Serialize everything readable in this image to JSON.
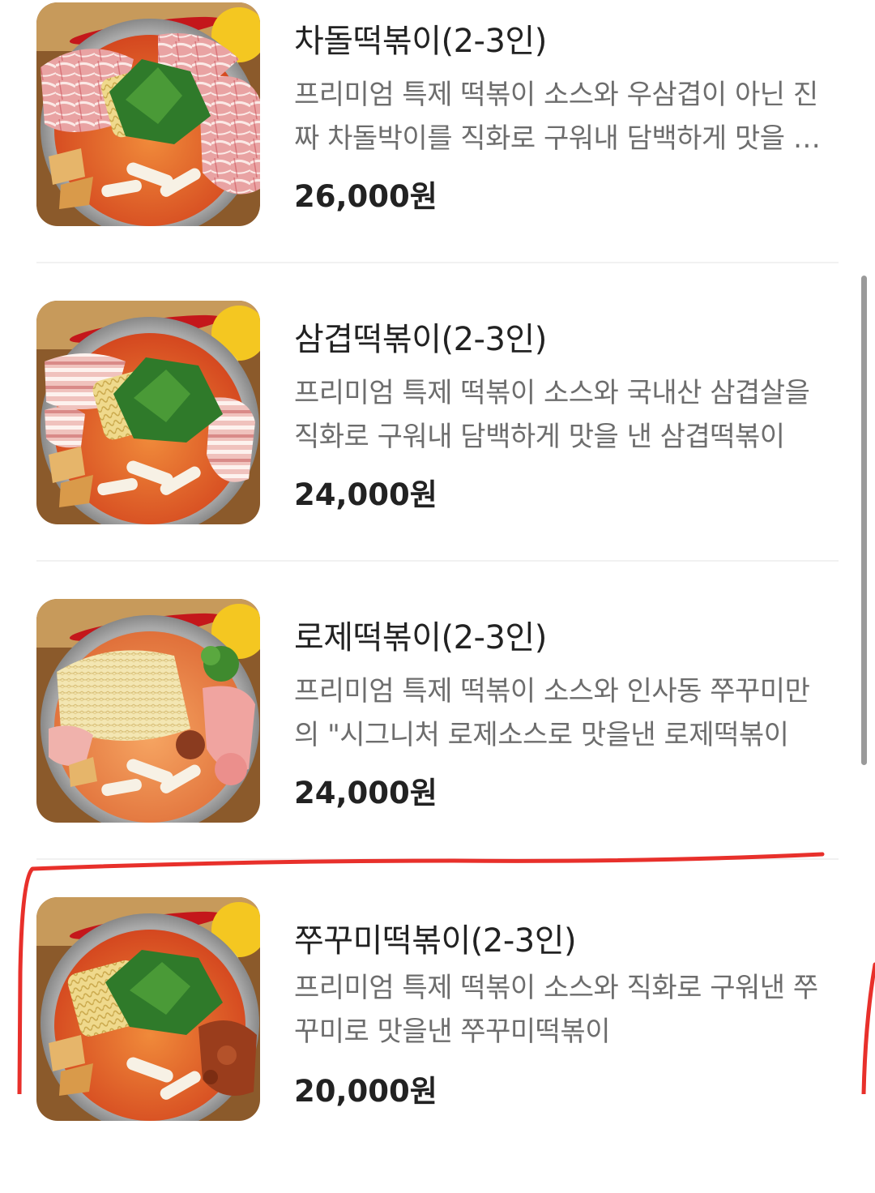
{
  "menu_items": [
    {
      "title": "차돌떡볶이(2-3인)",
      "description": "프리미엄 특제 떡볶이 소스와 우삼겹이 아닌 진짜 차돌박이를 직화로 구워내 담백하게 맛을 낸 차돌떡볶이",
      "price": "26,000원",
      "image": "chadol-tteokbokki-photo"
    },
    {
      "title": "삼겹떡볶이(2-3인)",
      "description": "프리미엄 특제 떡볶이 소스와 국내산 삼겹살을 직화로 구워내 담백하게 맛을 낸 삼겹떡볶이",
      "price": "24,000원",
      "image": "samgyeop-tteokbokki-photo"
    },
    {
      "title": "로제떡볶이(2-3인)",
      "description": "프리미엄 특제 떡볶이 소스와 인사동 쭈꾸미만의 \"시그니처 로제소스로 맛을낸 로제떡볶이",
      "price": "24,000원",
      "image": "rose-tteokbokki-photo"
    },
    {
      "title": "쭈꾸미떡볶이(2-3인)",
      "description": "프리미엄 특제 떡볶이 소스와 직화로 구워낸 쭈꾸미로 맛을낸 쭈꾸미떡볶이",
      "price": "20,000원",
      "image": "jjukkumi-tteokbokki-photo"
    }
  ],
  "colors": {
    "annotation": "#e8302b",
    "title": "#222222",
    "description": "#6d6d6d",
    "divider": "#f1f1f1"
  }
}
